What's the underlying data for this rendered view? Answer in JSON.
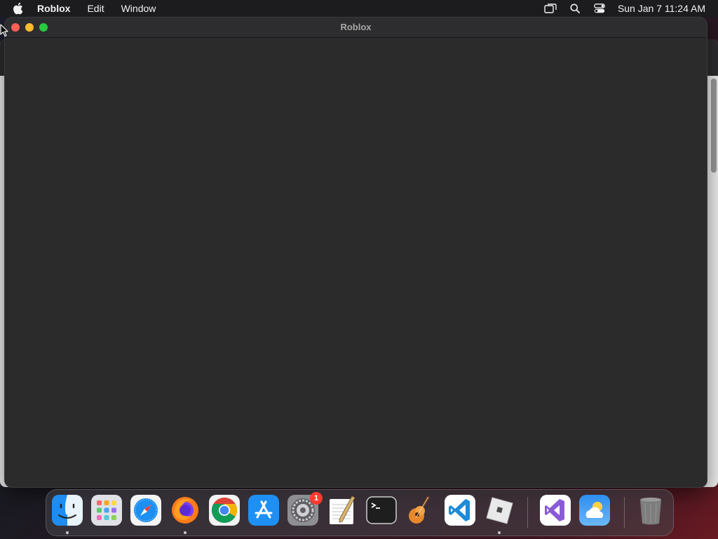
{
  "menubar": {
    "app_name": "Roblox",
    "items": [
      "Edit",
      "Window"
    ],
    "clock": "Sun Jan 7  11:24 AM",
    "status_icons": [
      "screen-mirroring-icon",
      "spotlight-search-icon",
      "control-center-icon"
    ]
  },
  "window": {
    "title": "Roblox"
  },
  "dock": {
    "apps": [
      {
        "name": "Finder",
        "icon": "finder-icon",
        "running": true
      },
      {
        "name": "Launchpad",
        "icon": "launchpad-icon",
        "running": false
      },
      {
        "name": "Safari",
        "icon": "safari-icon",
        "running": false
      },
      {
        "name": "Firefox",
        "icon": "firefox-icon",
        "running": true
      },
      {
        "name": "Google Chrome",
        "icon": "chrome-icon",
        "running": false
      },
      {
        "name": "App Store",
        "icon": "app-store-icon",
        "running": false
      },
      {
        "name": "System Settings",
        "icon": "system-settings-icon",
        "running": false,
        "badge": "1"
      },
      {
        "name": "TextEdit",
        "icon": "textedit-icon",
        "running": false
      },
      {
        "name": "Terminal",
        "icon": "terminal-icon",
        "running": false
      },
      {
        "name": "GarageBand",
        "icon": "garageband-icon",
        "running": false
      },
      {
        "name": "Visual Studio Code",
        "icon": "vscode-icon",
        "running": false
      },
      {
        "name": "Roblox",
        "icon": "roblox-icon",
        "running": true
      },
      {
        "name": "Visual Studio",
        "icon": "visual-studio-icon",
        "running": false
      },
      {
        "name": "Weather",
        "icon": "weather-icon",
        "running": false
      },
      {
        "name": "Trash",
        "icon": "trash-icon",
        "running": false
      }
    ]
  },
  "colors": {
    "close": "#ff5f57",
    "minimize": "#febc2e",
    "zoom": "#28c840",
    "badge": "#ff3b30"
  }
}
